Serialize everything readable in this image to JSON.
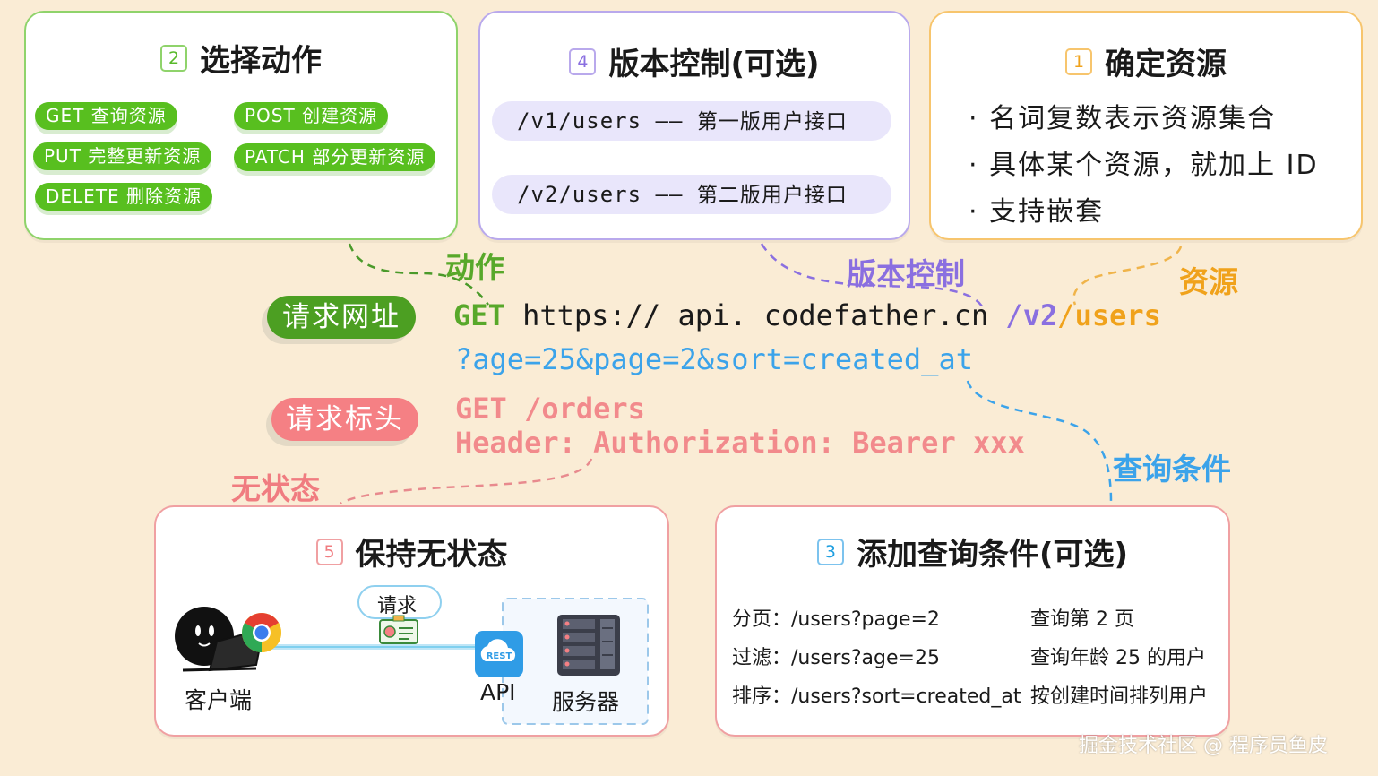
{
  "colors": {
    "background": "#faecd5",
    "green": "#58bf1f",
    "purple": "#8a6fe0",
    "orange": "#f0a21b",
    "blue": "#3ba3ea",
    "red": "#f07c80"
  },
  "card_actions": {
    "number": "2",
    "title": "选择动作",
    "pills": [
      "GET 查询资源",
      "POST 创建资源",
      "PUT 完整更新资源",
      "PATCH 部分更新资源",
      "DELETE 删除资源"
    ]
  },
  "card_version": {
    "number": "4",
    "title": "版本控制(可选)",
    "rows": [
      {
        "path": "/v1/users",
        "dash": " —— ",
        "desc": "第一版用户接口"
      },
      {
        "path": "/v2/users",
        "dash": " —— ",
        "desc": "第二版用户接口"
      }
    ]
  },
  "card_resource": {
    "number": "1",
    "title": "确定资源",
    "lines": [
      "· 名词复数表示资源集合",
      "· 具体某个资源，就加上 ID",
      "· 支持嵌套"
    ]
  },
  "card_stateless": {
    "number": "5",
    "title": "保持无状态",
    "request_label": "请求",
    "client_label": "客户端",
    "api_label": "API",
    "rest_label": "REST",
    "server_label": "服务器",
    "client_icon": "person-laptop-icon",
    "browser_icon": "chrome-icon",
    "request_icon": "id-card-icon",
    "api_icon": "cloud-rest-icon",
    "server_icon": "server-rack-icon"
  },
  "card_query": {
    "number": "3",
    "title": "添加查询条件(可选)",
    "rows": [
      {
        "key": "分页：",
        "path": "/users?page=2",
        "desc": "查询第 2 页"
      },
      {
        "key": "过滤：",
        "path": "/users?age=25",
        "desc": "查询年龄 25 的用户"
      },
      {
        "key": "排序：",
        "path": "/users?sort=created_at",
        "desc": "按创建时间排列用户"
      }
    ]
  },
  "labels": {
    "action": "动作",
    "version": "版本控制",
    "resource": "资源",
    "query": "查询条件",
    "stateless": "无状态"
  },
  "request_url": {
    "tag": "请求网址",
    "method": "GET",
    "host": " https:// api. codefather.cn ",
    "slash1": "/",
    "version": "v2",
    "slash2": "/",
    "resource": "users",
    "query": "?age=25&page=2&sort=created_at"
  },
  "request_header": {
    "tag": "请求标头",
    "line1": "GET /orders",
    "line2": "Header: Authorization: Bearer xxx"
  },
  "watermark": "掘金技术社区 @ 程序员鱼皮"
}
